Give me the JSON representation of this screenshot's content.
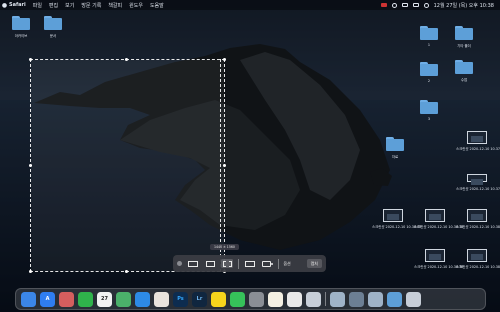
{
  "menubar": {
    "app_name": "Safari",
    "items": [
      "파일",
      "편집",
      "보기",
      "방문 기록",
      "책갈피",
      "윈도우",
      "도움말"
    ],
    "clock": "12월 27일 (목) 오후 10:38"
  },
  "desktop": {
    "left_icons": [
      {
        "label": "아카이브"
      },
      {
        "label": "문서"
      }
    ],
    "right_folders": [
      {
        "label": "1"
      },
      {
        "label": "기타 폴더"
      },
      {
        "label": "2"
      },
      {
        "label": "수업"
      },
      {
        "label": "3"
      }
    ],
    "center_folder": {
      "label": "자료"
    },
    "screenshots": [
      {
        "label": "스크린샷 2020-12-10 10.37.34"
      },
      {
        "label": "스크린샷 2020-12-10 10.37.38"
      },
      {
        "label": "스크린샷 2020-12-10 10.38.03"
      },
      {
        "label": "스크린샷 2020-12-10 10.38.14"
      },
      {
        "label": "스크린샷 2020-12-10 10.38.30"
      },
      {
        "label": "스크린샷 2020-12-10 10.38.36"
      },
      {
        "label": "스크린샷 2020-12-10 10.38.41"
      },
      {
        "label": "스크린샷 2020-12-10 10.38.48"
      }
    ]
  },
  "selection": {
    "dimensions_label": "1440 × 1560"
  },
  "toolbar": {
    "options_label": "옵션",
    "capture_label": "캡처"
  },
  "dock": {
    "apps": [
      {
        "icon": "finder-icon",
        "color": "#3b86e8",
        "glyph": ""
      },
      {
        "icon": "app-store-icon",
        "color": "#2f7df0",
        "glyph": "A"
      },
      {
        "icon": "launchpad-icon",
        "color": "#d45e5e",
        "glyph": ""
      },
      {
        "icon": "facetime-icon",
        "color": "#2fb24b",
        "glyph": ""
      },
      {
        "icon": "calendar-icon",
        "color": "#f2f2f2",
        "glyph": "27"
      },
      {
        "icon": "maps-icon",
        "color": "#4bb06a",
        "glyph": ""
      },
      {
        "icon": "safari-icon",
        "color": "#2d8ae6",
        "glyph": ""
      },
      {
        "icon": "photos-icon",
        "color": "#e9e3dc",
        "glyph": ""
      },
      {
        "icon": "photoshop-icon",
        "color": "#0d2c4f",
        "glyph": "Ps"
      },
      {
        "icon": "lightroom-icon",
        "color": "#10263f",
        "glyph": "Lr"
      },
      {
        "icon": "kakaotalk-icon",
        "color": "#f8d51c",
        "glyph": ""
      },
      {
        "icon": "messages-icon",
        "color": "#36c25a",
        "glyph": ""
      },
      {
        "icon": "settings-icon",
        "color": "#8a8e95",
        "glyph": ""
      },
      {
        "icon": "notes-icon",
        "color": "#f4f0e3",
        "glyph": ""
      },
      {
        "icon": "chrome-icon",
        "color": "#e9e9e9",
        "glyph": ""
      },
      {
        "icon": "preview-icon",
        "color": "#c7ced8",
        "glyph": ""
      }
    ],
    "stack": [
      {
        "icon": "downloads-stack-icon",
        "color": "#9fb3c8"
      },
      {
        "icon": "screenshot-stack-icon",
        "color": "#6c7f94"
      },
      {
        "icon": "documents-stack-icon",
        "color": "#9fb3c8"
      },
      {
        "icon": "folder-stack-icon",
        "color": "#5d9fd8"
      },
      {
        "icon": "trash-icon",
        "color": "#c7ced8"
      }
    ]
  }
}
